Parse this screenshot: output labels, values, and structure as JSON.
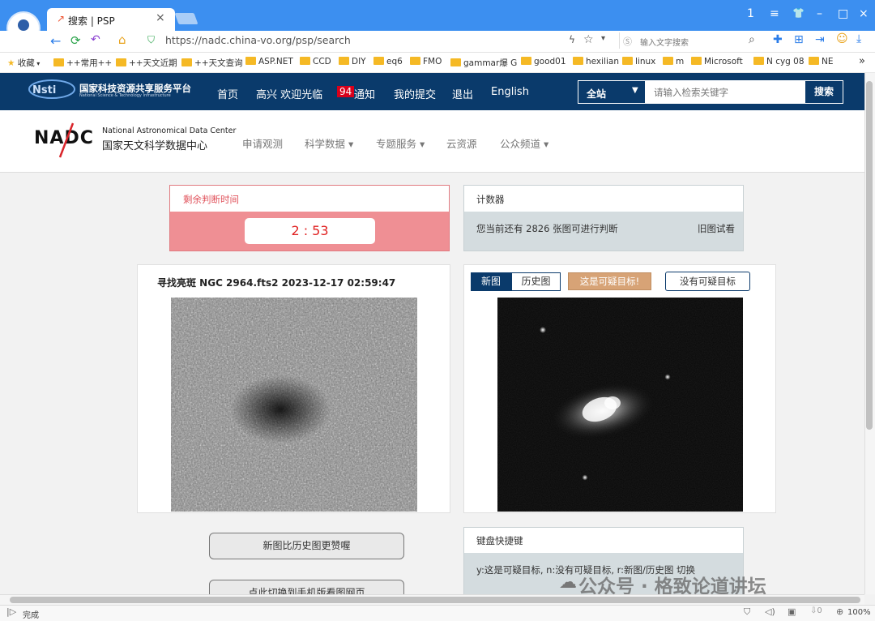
{
  "browser": {
    "tab_title": "搜索 | PSP",
    "tab_close": "×",
    "url": "https://nadc.china-vo.org/psp/search",
    "search_placeholder": "输入文字搜索",
    "window_controls": [
      "1",
      "≡",
      "👕",
      "–",
      "□",
      "×"
    ],
    "bookmarks": [
      "收藏",
      "++常用++",
      "++天文近期",
      "++天文查询",
      "ASP.NET",
      "CCD",
      "DIY",
      "eq6",
      "FMO",
      "gammar爆 G",
      "good01",
      "hexilian",
      "linux",
      "m",
      "Microsoft",
      "N cyg 08",
      "NE"
    ],
    "bookmarks_more": "»",
    "status_text": "完成",
    "zoom": "100%"
  },
  "site": {
    "platform_name": "国家科技资源共享服务平台",
    "platform_sub": "National Science & Technology Infrastructure",
    "nav": {
      "home": "首页",
      "welcome": "高兴 欢迎光临",
      "notice_count": "94",
      "notice": "通知",
      "my_submissions": "我的提交",
      "logout": "退出",
      "english": "English"
    },
    "search_scope": "全站",
    "search_placeholder": "请输入检索关键字",
    "search_button": "搜索",
    "nadc_logo": "NADC",
    "nadc_en": "National Astronomical Data Center",
    "nadc_cn": "国家天文科学数据中心",
    "menu": [
      "申请观测",
      "科学数据 ▾",
      "专题服务 ▾",
      "云资源",
      "公众频道 ▾"
    ]
  },
  "timer": {
    "title": "剩余判断时间",
    "value": "2 : 53"
  },
  "counter": {
    "title": "计数器",
    "text": "您当前还有 2826 张图可进行判断",
    "old_image_link": "旧图试看"
  },
  "left_panel": {
    "caption": "寻找亮斑   NGC 2964.fts2  2023-12-17 02:59:47"
  },
  "right_panel": {
    "tab_new": "新图",
    "tab_history": "历史图",
    "btn_suspect": "这是可疑目标!",
    "btn_none": "没有可疑目标"
  },
  "buttons": {
    "better": "新图比历史图更赞喔",
    "mobile": "点此切换到手机版看图网页"
  },
  "shortcuts": {
    "title": "键盘快捷键",
    "text": "y:这是可疑目标, n:没有可疑目标, r:新图/历史图 切换"
  },
  "watermark": "公众号 · 格致论道讲坛",
  "colors": {
    "header_navy": "#0a3a6b",
    "timer_pink": "#ef8f94",
    "suspect_button": "#d7a376",
    "browser_blue": "#3c8ff0"
  }
}
